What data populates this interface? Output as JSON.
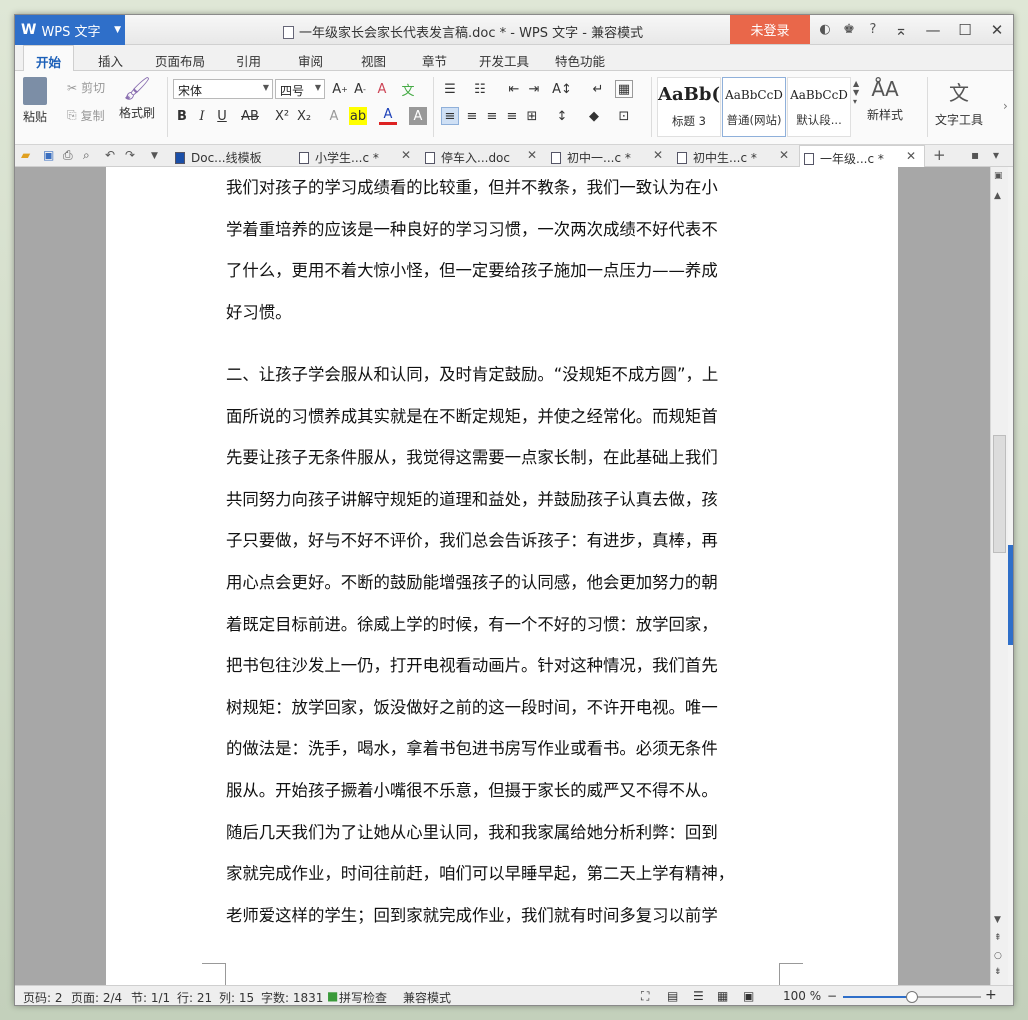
{
  "app": {
    "name": "WPS 文字",
    "title": "一年级家长会家长代表发言稿.doc * - WPS 文字 - 兼容模式",
    "login": "未登录"
  },
  "menu": [
    "开始",
    "插入",
    "页面布局",
    "引用",
    "审阅",
    "视图",
    "章节",
    "开发工具",
    "特色功能"
  ],
  "ribbon": {
    "paste": "粘贴",
    "cut": "剪切",
    "copy": "复制",
    "format_painter": "格式刷",
    "font_name": "宋体",
    "font_size": "四号",
    "styles": [
      {
        "sample": "AaBb(",
        "name": "标题 3"
      },
      {
        "sample": "AaBbCcD",
        "name": "普通(网站)"
      },
      {
        "sample": "AaBbCcD",
        "name": "默认段..."
      }
    ],
    "new_style": "新样式",
    "text_tools": "文字工具"
  },
  "doc_tabs": [
    {
      "label": "Doc...线模板",
      "active": false
    },
    {
      "label": "小学生...c *",
      "active": false
    },
    {
      "label": "停车入...doc",
      "active": false
    },
    {
      "label": "初中一...c *",
      "active": false
    },
    {
      "label": "初中生...c *",
      "active": false
    },
    {
      "label": "一年级...c *",
      "active": true
    }
  ],
  "document": {
    "lines_p1": [
      "我们对孩子的学习成绩看的比较重，但并不教条，我们一致认为在小",
      "学着重培养的应该是一种良好的学习习惯，一次两次成绩不好代表不",
      "了什么，更用不着大惊小怪，但一定要给孩子施加一点压力——养成",
      "好习惯。"
    ],
    "lines_p2": [
      "二、让孩子学会服从和认同，及时肯定鼓励。“没规矩不成方圆”，上",
      "面所说的习惯养成其实就是在不断定规矩，并使之经常化。而规矩首",
      "先要让孩子无条件服从，我觉得这需要一点家长制，在此基础上我们",
      "共同努力向孩子讲解守规矩的道理和益处，并鼓励孩子认真去做，孩",
      "子只要做，好与不好不评价，我们总会告诉孩子：有进步，真棒，再",
      "用心点会更好。不断的鼓励能增强孩子的认同感，他会更加努力的朝",
      "着既定目标前进。徐威上学的时候，有一个不好的习惯：放学回家，",
      "把书包往沙发上一仍，打开电视看动画片。针对这种情况，我们首先",
      "树规矩：放学回家，饭没做好之前的这一段时间，不许开电视。唯一",
      "的做法是：洗手，喝水，拿着书包进书房写作业或看书。必须无条件",
      "服从。开始孩子撅着小嘴很不乐意，但摄于家长的威严又不得不从。",
      "随后几天我们为了让她从心里认同，我和我家属给她分析利弊：回到",
      "家就完成作业，时间往前赶，咱们可以早睡早起，第二天上学有精神，",
      "老师爱这样的学生；回到家就完成作业，我们就有时间多复习以前学"
    ]
  },
  "status": {
    "page_code": "页码: 2",
    "pages": "页面: 2/4",
    "section": "节: 1/1",
    "row": "行: 21",
    "col": "列: 15",
    "words": "字数: 1831",
    "spell": "拼写检查",
    "compat": "兼容模式",
    "zoom": "100 %",
    "zoom_level": 0.5
  },
  "colors": {
    "accent": "#2f6fc9",
    "login": "#e9674a"
  }
}
